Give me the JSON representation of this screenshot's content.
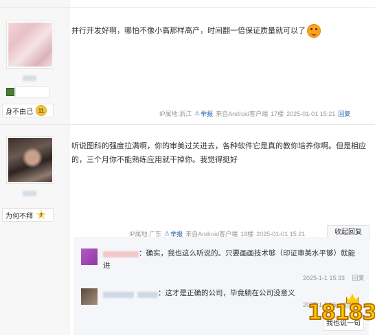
{
  "posts": [
    {
      "user": {
        "badge_text": "身不由己",
        "badge_level": "11"
      },
      "content": "并行开发好啊，哪怕不像小高那样高产，时间翻一倍保证质量就可以了",
      "meta": {
        "ip": "IP属地:浙江",
        "report": "举报",
        "source": "来自Android客户端",
        "floor": "17楼",
        "time": "2025-01-01 15:21",
        "reply": "回复"
      }
    },
    {
      "user": {
        "badge_text": "为何不拜",
        "badge_level": "7"
      },
      "content_line1": "听说图科的强度拉满啊，你的审美过关进去，各种软件它是真的教你培养你啊。但是相应",
      "content_line2": "的，三个月你不能熟练应用就干掉你。我觉得挺好",
      "meta": {
        "ip": "IP属地:广东",
        "report": "举报",
        "source": "来自Android客户端",
        "floor": "18楼",
        "time": "2025-01-01 15:21",
        "reply": "收起回复"
      }
    }
  ],
  "sub_replies": [
    {
      "text_line1": "：确实，我也这么听说的。只要画画技术够（印证审美水平够）就能",
      "text_line2": "进",
      "time": "2025-1-1 15:33",
      "reply": "回复"
    },
    {
      "text": "：这才是正确的公司，毕竟躺在公司没意义",
      "time": "2025-1-1 16:",
      "reply": "回复"
    }
  ],
  "footer": {
    "say_button": "我也说一句"
  },
  "watermark": {
    "logo_text": "18183"
  },
  "colors": {
    "link_blue": "#2d64b3",
    "sidebar_bg": "#f7f7f7",
    "reply_block_bg": "#f4f6f9",
    "logo_yellow": "#ffcc00"
  }
}
